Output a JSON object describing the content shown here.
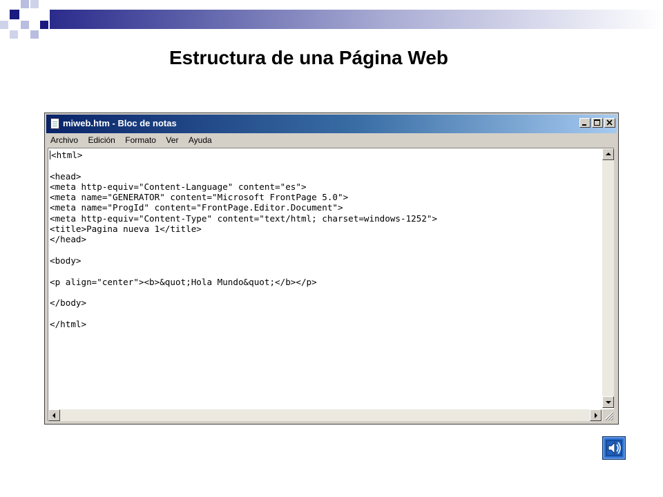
{
  "slide": {
    "title": "Estructura de una Página Web"
  },
  "window": {
    "title": "miweb.htm - Bloc de notas",
    "buttons": {
      "minimize": "_",
      "maximize": "□",
      "close": "×"
    },
    "menu": [
      {
        "label": "Archivo"
      },
      {
        "label": "Edición"
      },
      {
        "label": "Formato"
      },
      {
        "label": "Ver"
      },
      {
        "label": "Ayuda"
      }
    ],
    "lines": [
      "<html>",
      "",
      "<head>",
      "<meta http-equiv=\"Content-Language\" content=\"es\">",
      "<meta name=\"GENERATOR\" content=\"Microsoft FrontPage 5.0\">",
      "<meta name=\"ProgId\" content=\"FrontPage.Editor.Document\">",
      "<meta http-equiv=\"Content-Type\" content=\"text/html; charset=windows-1252\">",
      "<title>Pagina nueva 1</title>",
      "</head>",
      "",
      "<body>",
      "",
      "<p align=\"center\"><b>&quot;Hola Mundo&quot;</b></p>",
      "",
      "</body>",
      "",
      "</html>"
    ]
  },
  "colors": {
    "accent_dark": "#1a1a80",
    "titlebar_start": "#0a246a",
    "titlebar_end": "#a6caf0",
    "window_face": "#d4d0c8"
  },
  "icons": {
    "app": "notepad-icon",
    "action": "sound-action-button-icon"
  }
}
